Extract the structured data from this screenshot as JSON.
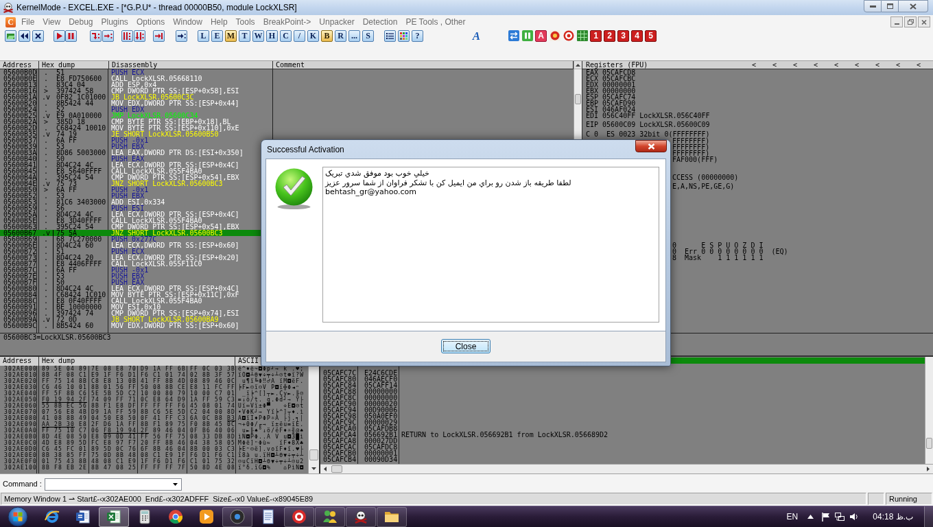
{
  "window": {
    "title": "KernelMode - EXCEL.EXE - [*G.P.U* - thread 00000B50, module LockXLSR]"
  },
  "menu": {
    "app_icon_letter": "C",
    "items": [
      "File",
      "View",
      "Debug",
      "Plugins",
      "Options",
      "Window",
      "Help",
      "Tools",
      "BreakPoint->",
      "Unpacker",
      "Detection",
      "PE Tools , Other"
    ]
  },
  "toolbar": {
    "view_buttons": [
      {
        "label": "L",
        "on": false
      },
      {
        "label": "E",
        "on": false
      },
      {
        "label": "M",
        "on": true
      },
      {
        "label": "T",
        "on": false
      },
      {
        "label": "W",
        "on": false
      },
      {
        "label": "H",
        "on": false
      },
      {
        "label": "C",
        "on": false
      },
      {
        "label": "/",
        "on": false
      },
      {
        "label": "K",
        "on": false
      },
      {
        "label": "B",
        "on": true
      },
      {
        "label": "R",
        "on": false
      },
      {
        "label": "...",
        "on": false
      },
      {
        "label": "S",
        "on": false
      }
    ],
    "help_button": "?",
    "logo_letter": "A",
    "plugin_letter": "A",
    "number_buttons": [
      "1",
      "2",
      "3",
      "4",
      "5"
    ]
  },
  "disassembly": {
    "columns": [
      "Address",
      "Hex dump",
      "Disassembly",
      "Comment"
    ],
    "rows": [
      {
        "address": "05600B0D",
        "marker": ".",
        "hex": "51",
        "instruction": "PUSH ECX",
        "kind": "push",
        "selected": false,
        "jump_line": false
      },
      {
        "address": "05600B0E",
        "marker": ".",
        "hex": "E8 FD750600",
        "instruction": "CALL LockXLSR.05668110",
        "kind": "other",
        "selected": false,
        "jump_line": false
      },
      {
        "address": "05600B13",
        "marker": ".",
        "hex": "83C4 04",
        "instruction": "ADD ESP,0x4",
        "kind": "other",
        "selected": false,
        "jump_line": false
      },
      {
        "address": "05600B16",
        "marker": ">",
        "hex": "397424 58",
        "instruction": "CMP DWORD PTR SS:[ESP+0x58],ESI",
        "kind": "other",
        "selected": false,
        "jump_line": false
      },
      {
        "address": "05600B1A",
        "marker": ".v",
        "hex": "0F82 1C01000",
        "instruction": "JB LockXLSR.05600C3C",
        "kind": "jcc",
        "selected": false,
        "jump_line": false
      },
      {
        "address": "05600B20",
        "marker": ".",
        "hex": "8B5424 44",
        "instruction": "MOV EDX,DWORD PTR SS:[ESP+0x44]",
        "kind": "other",
        "selected": false,
        "jump_line": false
      },
      {
        "address": "05600B24",
        "marker": ".",
        "hex": "52",
        "instruction": "PUSH EDX",
        "kind": "push",
        "selected": false,
        "jump_line": false
      },
      {
        "address": "05600B25",
        "marker": ".v",
        "hex": "E9 0A010000",
        "instruction": "JMP LockXLSR.05600C34",
        "kind": "jmp",
        "selected": false,
        "jump_line": false
      },
      {
        "address": "05600B2A",
        "marker": ">",
        "hex": "385D 18",
        "instruction": "CMP BYTE PTR SS:[EBP+0x18],BL",
        "kind": "other",
        "selected": false,
        "jump_line": false
      },
      {
        "address": "05600B2D",
        "marker": ".",
        "hex": "C68424 10010",
        "instruction": "MOV BYTE PTR SS:[ESP+0x110],0xE",
        "kind": "other",
        "selected": false,
        "jump_line": false
      },
      {
        "address": "05600B35",
        "marker": ".v",
        "hex": "74 19",
        "instruction": "JE SHORT LockXLSR.05600B50",
        "kind": "jcc",
        "selected": false,
        "jump_line": false
      },
      {
        "address": "05600B37",
        "marker": ".",
        "hex": "6A FF",
        "instruction": "PUSH -0x1",
        "kind": "push",
        "selected": false,
        "jump_line": false
      },
      {
        "address": "05600B39",
        "marker": ".",
        "hex": "53",
        "instruction": "PUSH EBX",
        "kind": "push",
        "selected": false,
        "jump_line": false
      },
      {
        "address": "05600B3A",
        "marker": ".",
        "hex": "8D86 5003000",
        "instruction": "LEA EAX,DWORD PTR DS:[ESI+0x350]",
        "kind": "other",
        "selected": false,
        "jump_line": false
      },
      {
        "address": "05600B40",
        "marker": ".",
        "hex": "50",
        "instruction": "PUSH EAX",
        "kind": "push",
        "selected": false,
        "jump_line": false
      },
      {
        "address": "05600B41",
        "marker": ".",
        "hex": "8D4C24 4C",
        "instruction": "LEA ECX,DWORD PTR SS:[ESP+0x4C]",
        "kind": "other",
        "selected": false,
        "jump_line": false
      },
      {
        "address": "05600B45",
        "marker": ".",
        "hex": "E8 5640FFFF",
        "instruction": "CALL LockXLSR.055F4BA0",
        "kind": "other",
        "selected": false,
        "jump_line": false
      },
      {
        "address": "05600B4A",
        "marker": ".",
        "hex": "395C24 54",
        "instruction": "CMP DWORD PTR SS:[ESP+0x54],EBX",
        "kind": "other",
        "selected": false,
        "jump_line": false
      },
      {
        "address": "05600B4E",
        "marker": ".v",
        "hex": "75 73",
        "instruction": "JNZ SHORT LockXLSR.05600BC3",
        "kind": "jcc",
        "selected": false,
        "jump_line": false
      },
      {
        "address": "05600B50",
        "marker": ">",
        "hex": "6A FF",
        "instruction": "PUSH -0x1",
        "kind": "push",
        "selected": false,
        "jump_line": false
      },
      {
        "address": "05600B52",
        "marker": ".",
        "hex": "53",
        "instruction": "PUSH EBX",
        "kind": "push",
        "selected": false,
        "jump_line": false
      },
      {
        "address": "05600B53",
        "marker": ".",
        "hex": "81C6 3403000",
        "instruction": "ADD ESI,0x334",
        "kind": "other",
        "selected": false,
        "jump_line": false
      },
      {
        "address": "05600B59",
        "marker": ".",
        "hex": "56",
        "instruction": "PUSH ESI",
        "kind": "push",
        "selected": false,
        "jump_line": false
      },
      {
        "address": "05600B5A",
        "marker": ".",
        "hex": "8D4C24 4C",
        "instruction": "LEA ECX,DWORD PTR SS:[ESP+0x4C]",
        "kind": "other",
        "selected": false,
        "jump_line": false
      },
      {
        "address": "05600B5E",
        "marker": ".",
        "hex": "E8 3D40FFFF",
        "instruction": "CALL LockXLSR.055F4BA0",
        "kind": "other",
        "selected": false,
        "jump_line": false
      },
      {
        "address": "05600B63",
        "marker": ".",
        "hex": "395C24 54",
        "instruction": "CMP DWORD PTR SS:[ESP+0x54],EBX",
        "kind": "other",
        "selected": false,
        "jump_line": false
      },
      {
        "address": "05600B67",
        "marker": ".v",
        "hex": "75 5A",
        "instruction": "JNZ SHORT LockXLSR.05600BC3",
        "kind": "jcc",
        "selected": true,
        "jump_line": true
      },
      {
        "address": "05600B69",
        "marker": ".",
        "hex": "68 7C270000",
        "instruction": "PUSH 0x277C",
        "kind": "push",
        "selected": false,
        "jump_line": true
      },
      {
        "address": "05600B6E",
        "marker": ".",
        "hex": "8D4C24 60",
        "instruction": "LEA ECX,DWORD PTR SS:[ESP+0x60]",
        "kind": "other",
        "selected": false,
        "jump_line": true
      },
      {
        "address": "05600B72",
        "marker": ".",
        "hex": "51",
        "instruction": "PUSH ECX",
        "kind": "push",
        "selected": false,
        "jump_line": true
      },
      {
        "address": "05600B73",
        "marker": ".",
        "hex": "8D4C24 20",
        "instruction": "LEA ECX,DWORD PTR SS:[ESP+0x20]",
        "kind": "other",
        "selected": false,
        "jump_line": true
      },
      {
        "address": "05600B77",
        "marker": ".",
        "hex": "E8 4406FFFF",
        "instruction": "CALL LockXLSR.055F11C0",
        "kind": "other",
        "selected": false,
        "jump_line": true
      },
      {
        "address": "05600B7C",
        "marker": ".",
        "hex": "6A FF",
        "instruction": "PUSH -0x1",
        "kind": "push",
        "selected": false,
        "jump_line": true
      },
      {
        "address": "05600B7E",
        "marker": ".",
        "hex": "53",
        "instruction": "PUSH EBX",
        "kind": "push",
        "selected": false,
        "jump_line": true
      },
      {
        "address": "05600B7F",
        "marker": ".",
        "hex": "50",
        "instruction": "PUSH EAX",
        "kind": "push",
        "selected": false,
        "jump_line": true
      },
      {
        "address": "05600B80",
        "marker": ".",
        "hex": "8D4C24 4C",
        "instruction": "LEA ECX,DWORD PTR SS:[ESP+0x4C]",
        "kind": "other",
        "selected": false,
        "jump_line": true
      },
      {
        "address": "05600B84",
        "marker": ".",
        "hex": "C68424 1C010",
        "instruction": "MOV BYTE PTR SS:[ESP+0x11C],0xF",
        "kind": "other",
        "selected": false,
        "jump_line": true
      },
      {
        "address": "05600B8C",
        "marker": ".",
        "hex": "E8 0F40FFFF",
        "instruction": "CALL LockXLSR.055F4BA0",
        "kind": "other",
        "selected": false,
        "jump_line": true
      },
      {
        "address": "05600B91",
        "marker": ".",
        "hex": "BE 10000000",
        "instruction": "MOV ESI,0x10",
        "kind": "other",
        "selected": false,
        "jump_line": true
      },
      {
        "address": "05600B96",
        "marker": ".",
        "hex": "397424 74",
        "instruction": "CMP DWORD PTR SS:[ESP+0x74],ESI",
        "kind": "other",
        "selected": false,
        "jump_line": true
      },
      {
        "address": "05600B9A",
        "marker": ".v",
        "hex": "72 0D",
        "instruction": "JB SHORT LockXLSR.05600BA9",
        "kind": "jcc",
        "selected": false,
        "jump_line": true
      },
      {
        "address": "05600B9C",
        "marker": ".",
        "hex": "8B5424 60",
        "instruction": "MOV EDX,DWORD PTR SS:[ESP+0x60]",
        "kind": "other",
        "selected": false,
        "jump_line": true
      }
    ],
    "info": "05600BC3=LockXLSR.05600BC3"
  },
  "registers": {
    "title": "Registers (FPU)",
    "arrows": [
      "<",
      "<",
      "<",
      "<",
      "<",
      "<",
      "<",
      "<",
      "<"
    ],
    "general": [
      {
        "name": "EAX",
        "value": "05CAFCD8"
      },
      {
        "name": "ECX",
        "value": "05CAFCBC"
      },
      {
        "name": "EDX",
        "value": "00000001"
      },
      {
        "name": "EBX",
        "value": "00000000"
      },
      {
        "name": "ESP",
        "value": "05CAFC74"
      },
      {
        "name": "EBP",
        "value": "05CAFD90"
      },
      {
        "name": "ESI",
        "value": "046AF024"
      },
      {
        "name": "EDI",
        "value": "056C40FF",
        "comment": "LockXLSR.056C40FF"
      }
    ],
    "eip": {
      "name": "EIP",
      "value": "05600C09",
      "comment": "LockXLSR.05600C09"
    },
    "flag_line": "C 0  ES 0023 32bit 0(FFFFFFFF)",
    "partly_hidden": [
      [
        "FFFFFFFF)",
        "FFFFFFFF)",
        "FFFFFFFF)",
        "FAF000(FFF)"
      ],
      [
        "CCESS (00000000)"
      ],
      [
        "E,A,NS,PE,GE,G)"
      ],
      [
        "0      E S P U O Z D I",
        "0  Err 0 0 0 0 0 0 0 0  (EQ)",
        "8  Mask    1 1 1 1 1 1"
      ]
    ]
  },
  "dump": {
    "columns": [
      "Address",
      "Hex dump",
      "ASCII"
    ],
    "rows": [
      {
        "address": "302AE000",
        "hex": [
          "89",
          "5E",
          "04",
          "89",
          "7E",
          "08",
          "E8",
          "70",
          "D9",
          "1A",
          "FF",
          "6B",
          "FF",
          "0C",
          "03",
          "3B"
        ],
        "fixup": [
          false,
          false,
          false,
          false,
          false,
          false,
          false,
          false,
          false,
          false,
          false,
          false,
          false,
          false,
          false,
          false
        ],
        "ascii": "ë^♦ë~◘Φp┘→ k .♥;"
      },
      {
        "address": "302AE010",
        "hex": [
          "8B",
          "4F",
          "08",
          "C1",
          "E9",
          "1F",
          "F6",
          "D1",
          "F6",
          "C1",
          "01",
          "74",
          "02",
          "8B",
          "3F",
          "57"
        ],
        "fixup": [
          false,
          false,
          false,
          false,
          false,
          false,
          false,
          false,
          false,
          false,
          false,
          false,
          false,
          false,
          false,
          false
        ],
        "ascii": "ïO◘┴Θ▼÷╤÷┴☺t☻ï?W"
      },
      {
        "address": "302AE020",
        "hex": [
          "FF",
          "75",
          "14",
          "8B",
          "C8",
          "E8",
          "13",
          "0B",
          "41",
          "FF",
          "8B",
          "4D",
          "08",
          "89",
          "46",
          "0C"
        ],
        "fixup": [
          false,
          false,
          false,
          false,
          false,
          false,
          false,
          false,
          false,
          false,
          false,
          false,
          false,
          false,
          false,
          false
        ],
        "ascii": " u¶ï╚Φ‼♂A ïM◘ëF."
      },
      {
        "address": "302AE030",
        "hex": [
          "C6",
          "46",
          "10",
          "01",
          "8B",
          "01",
          "56",
          "FF",
          "50",
          "08",
          "8B",
          "CE",
          "E8",
          "11",
          "FC",
          "FF"
        ],
        "fixup": [
          false,
          false,
          false,
          false,
          false,
          false,
          false,
          false,
          false,
          false,
          false,
          false,
          false,
          false,
          false,
          false
        ],
        "ascii": "╞F►☺ï☺V P◘ï╬Φ◄ⁿ"
      },
      {
        "address": "302AE040",
        "hex": [
          "FF",
          "5F",
          "8B",
          "C6",
          "5E",
          "5B",
          "5D",
          "C2",
          "10",
          "00",
          "80",
          "79",
          "10",
          "00",
          "C7",
          "01"
        ],
        "fixup": [
          false,
          false,
          false,
          false,
          false,
          false,
          false,
          false,
          false,
          false,
          false,
          false,
          false,
          false,
          false,
          false
        ],
        "ascii": " _ï╞^[]┬►.Çy►.╟☺"
      },
      {
        "address": "302AE050",
        "hex": [
          "F0",
          "19",
          "94",
          "2F",
          "74",
          "09",
          "FF",
          "71",
          "0C",
          "E8",
          "64",
          "D9",
          "1A",
          "FF",
          "59",
          "C3"
        ],
        "fixup": [
          true,
          true,
          true,
          true,
          false,
          false,
          false,
          false,
          false,
          false,
          false,
          false,
          false,
          false,
          false,
          false
        ],
        "ascii": "≡↓ö/t. q.Φd┘→ Y├"
      },
      {
        "address": "302AE060",
        "hex": [
          "55",
          "8B",
          "EC",
          "56",
          "8B",
          "F1",
          "E8",
          "DF",
          "FF",
          "FF",
          "FF",
          "F6",
          "45",
          "08",
          "01",
          "74"
        ],
        "fixup": [
          false,
          false,
          false,
          false,
          false,
          false,
          false,
          false,
          false,
          false,
          false,
          false,
          false,
          false,
          false,
          false
        ],
        "ascii": "Uï∞Vï±Φ▀   ÷E◘☺t"
      },
      {
        "address": "302AE070",
        "hex": [
          "07",
          "56",
          "E8",
          "4B",
          "D9",
          "1A",
          "FF",
          "59",
          "8B",
          "C6",
          "5E",
          "5D",
          "C2",
          "04",
          "00",
          "8D"
        ],
        "fixup": [
          false,
          false,
          false,
          false,
          false,
          false,
          false,
          false,
          false,
          false,
          false,
          false,
          false,
          false,
          false,
          false
        ],
        "ascii": "•VΦK┘→ Yï╞^]┬♦.ì"
      },
      {
        "address": "302AE080",
        "hex": [
          "41",
          "08",
          "8B",
          "49",
          "04",
          "50",
          "E8",
          "50",
          "0F",
          "41",
          "FF",
          "C3",
          "6A",
          "0C",
          "B8",
          "B3"
        ],
        "fixup": [
          false,
          false,
          false,
          false,
          false,
          false,
          false,
          false,
          false,
          false,
          false,
          false,
          false,
          false,
          false,
          true
        ],
        "ascii": "A◘ïI♦PΦP☼A ├j.╕│"
      },
      {
        "address": "302AE090",
        "hex": [
          "AA",
          "2B",
          "30",
          "E8",
          "2F",
          "D6",
          "1A",
          "FF",
          "8B",
          "F1",
          "89",
          "75",
          "F0",
          "8B",
          "45",
          "0C"
        ],
        "fixup": [
          true,
          true,
          true,
          false,
          false,
          false,
          false,
          false,
          false,
          false,
          false,
          false,
          false,
          false,
          false,
          false
        ],
        "ascii": "¬+0Φ/╓→ ï±ëu≡ïE."
      },
      {
        "address": "302AE0A0",
        "hex": [
          "FF",
          "75",
          "10",
          "C7",
          "06",
          "F8",
          "19",
          "94",
          "2F",
          "89",
          "46",
          "04",
          "0F",
          "B6",
          "40",
          "06"
        ],
        "fixup": [
          false,
          false,
          false,
          false,
          false,
          true,
          true,
          true,
          true,
          false,
          false,
          false,
          false,
          false,
          false,
          false
        ],
        "ascii": " u►╟♠°↓ö/ëF♦☼╢@♠"
      },
      {
        "address": "302AE0B0",
        "hex": [
          "8D",
          "4E",
          "08",
          "50",
          "E8",
          "09",
          "0D",
          "41",
          "FF",
          "56",
          "FF",
          "75",
          "08",
          "33",
          "DB",
          "8D"
        ],
        "fixup": [
          false,
          false,
          false,
          false,
          false,
          false,
          false,
          false,
          false,
          false,
          false,
          false,
          false,
          false,
          false,
          false
        ],
        "ascii": "ìN◘PΦ..A V u◘3█ì"
      },
      {
        "address": "302AE0C0",
        "hex": [
          "4D",
          "E8",
          "89",
          "5D",
          "FC",
          "E8",
          "97",
          "F7",
          "20",
          "FF",
          "8B",
          "46",
          "04",
          "38",
          "58",
          "05"
        ],
        "fixup": [
          false,
          false,
          false,
          false,
          false,
          false,
          false,
          false,
          false,
          false,
          false,
          false,
          false,
          false,
          false,
          false
        ],
        "ascii": "MΦë]ⁿΦù≈  ïF♦8X♣"
      },
      {
        "address": "302AE0D0",
        "hex": [
          "C6",
          "45",
          "FC",
          "01",
          "89",
          "5D",
          "0C",
          "76",
          "6F",
          "8B",
          "46",
          "04",
          "8B",
          "00",
          "03",
          "C3"
        ],
        "fixup": [
          false,
          false,
          false,
          false,
          false,
          false,
          false,
          false,
          false,
          false,
          false,
          false,
          false,
          false,
          false,
          false
        ],
        "ascii": "╞Eⁿ☺ë].voïF♦ï.♥├"
      },
      {
        "address": "302AE0E0",
        "hex": [
          "8B",
          "38",
          "85",
          "FF",
          "75",
          "0D",
          "8B",
          "48",
          "08",
          "C1",
          "E9",
          "1F",
          "F6",
          "D1",
          "F6",
          "C1"
        ],
        "fixup": [
          false,
          false,
          false,
          false,
          false,
          false,
          false,
          false,
          false,
          false,
          false,
          false,
          false,
          false,
          false,
          false
        ],
        "ascii": "ï8à u.ïH◘┴Θ▼÷╤÷┴"
      },
      {
        "address": "302AE0F0",
        "hex": [
          "01",
          "75",
          "43",
          "8B",
          "48",
          "08",
          "C1",
          "E9",
          "1F",
          "F6",
          "D1",
          "F6",
          "C1",
          "01",
          "75",
          "32"
        ],
        "fixup": [
          false,
          false,
          false,
          false,
          false,
          false,
          false,
          false,
          false,
          false,
          false,
          false,
          false,
          false,
          false,
          false
        ],
        "ascii": "☺uCïH◘┴Θ▼÷╤÷┴☺u2"
      },
      {
        "address": "302AE100",
        "hex": [
          "8B",
          "F8",
          "EB",
          "2E",
          "8B",
          "47",
          "08",
          "25",
          "FF",
          "FF",
          "FF",
          "7F",
          "50",
          "8D",
          "4E",
          "08"
        ],
        "fixup": [
          false,
          false,
          false,
          false,
          false,
          false,
          false,
          false,
          false,
          false,
          false,
          false,
          false,
          false,
          false,
          false
        ],
        "ascii": "ï°δ.ïG◘%   ⌂PìN◘"
      }
    ]
  },
  "stack": {
    "rows": [
      {
        "address": "05CAFC7C",
        "value": "E24C6CDE"
      },
      {
        "address": "05CAFC80",
        "value": "046AECF0"
      },
      {
        "address": "05CAFC84",
        "value": "05CAFF14"
      },
      {
        "address": "05CAFC88",
        "value": "00000000"
      },
      {
        "address": "05CAFC8C",
        "value": "00000000"
      },
      {
        "address": "05CAFC90",
        "value": "00000020"
      },
      {
        "address": "05CAFC94",
        "value": "00D90006"
      },
      {
        "address": "05CAFC98",
        "value": "050A0EF0"
      },
      {
        "address": "05CAFC9C",
        "value": "00000029"
      },
      {
        "address": "05CAFCA0",
        "value": "05CAFDB8"
      },
      {
        "address": "05CAFCA4",
        "value": "056692B1",
        "comment": "RETURN to LockXLSR.056692B1 from LockXLSR.056689D2"
      },
      {
        "address": "05CAFCA8",
        "value": "000027DD"
      },
      {
        "address": "05CAFCAC",
        "value": "05CAFDC8"
      },
      {
        "address": "05CAFCB0",
        "value": "00000001"
      },
      {
        "address": "05CAFCB4",
        "value": "00090D34"
      }
    ]
  },
  "command": {
    "label": "Command :"
  },
  "status_bar": {
    "text": "Memory Window 1 ⇀ Start£-‹x302AE000  End£-‹x302ADFFF  Size£-‹x0 Value£-‹x89045E89",
    "state": "Running"
  },
  "taskbar": {
    "apps": [
      {
        "kind": "ie",
        "running": false,
        "active": false
      },
      {
        "kind": "word",
        "running": false,
        "active": false
      },
      {
        "kind": "excel",
        "running": true,
        "active": true
      },
      {
        "kind": "calculator",
        "running": false,
        "active": false
      },
      {
        "kind": "chrome",
        "running": false,
        "active": false
      },
      {
        "kind": "player",
        "running": false,
        "active": false
      },
      {
        "kind": "disc",
        "running": true,
        "active": false
      },
      {
        "kind": "notepad",
        "running": false,
        "active": false
      },
      {
        "kind": "target",
        "running": true,
        "active": false
      },
      {
        "kind": "messenger",
        "running": true,
        "active": false
      },
      {
        "kind": "skull",
        "running": true,
        "active": false
      },
      {
        "kind": "folder",
        "running": true,
        "active": false
      }
    ],
    "language": "EN",
    "clock": "04:18 ب.ظ"
  },
  "dialog": {
    "title": "Successful Activation",
    "message_lines": [
      "خيلي خوب بود موفق شدي تبريک",
      "لطفا طريقه باز شدن رو براي من ايميل کن با تشکر فراوان از شما سرور عزيز",
      "behtash_gr@yahoo.com"
    ],
    "button": "Close"
  }
}
